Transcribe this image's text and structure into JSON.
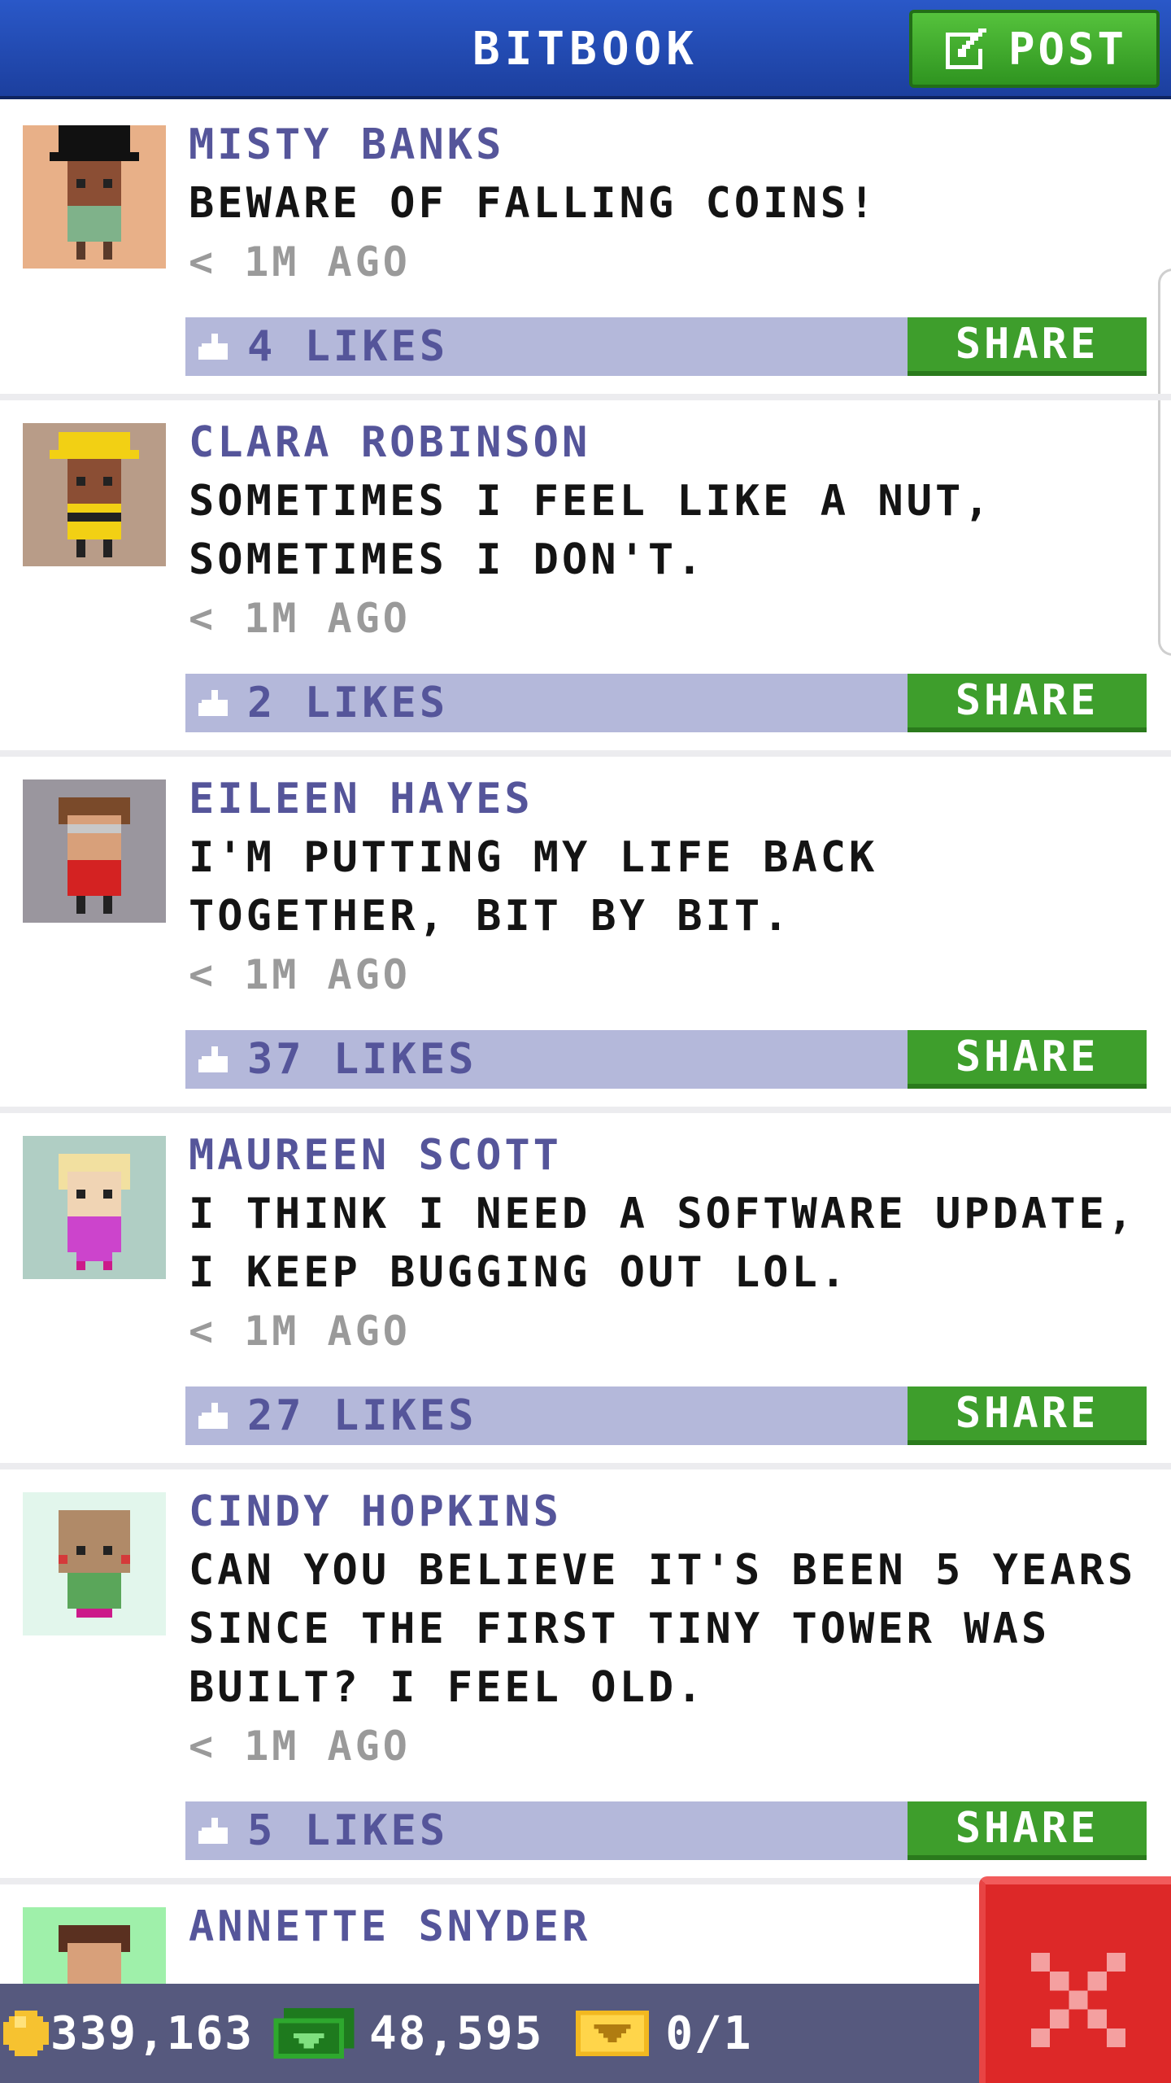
{
  "header": {
    "title": "BITBOOK",
    "post_label": "POST"
  },
  "posts": [
    {
      "name": "MISTY BANKS",
      "message": "BEWARE OF FALLING COINS!",
      "time": "< 1M AGO",
      "likes": "4 LIKES",
      "share": "SHARE"
    },
    {
      "name": "CLARA ROBINSON",
      "message": "SOMETIMES I FEEL LIKE A NUT, SOMETIMES I DON'T.",
      "time": "< 1M AGO",
      "likes": "2 LIKES",
      "share": "SHARE"
    },
    {
      "name": "EILEEN HAYES",
      "message": "I'M PUTTING MY LIFE BACK TOGETHER, BIT BY BIT.",
      "time": "< 1M AGO",
      "likes": "37 LIKES",
      "share": "SHARE"
    },
    {
      "name": "MAUREEN SCOTT",
      "message": "I THINK I NEED A SOFTWARE UPDATE, I KEEP BUGGING OUT LOL.",
      "time": "< 1M AGO",
      "likes": "27 LIKES",
      "share": "SHARE"
    },
    {
      "name": "CINDY HOPKINS",
      "message": "CAN YOU BELIEVE IT'S BEEN 5 YEARS SINCE THE FIRST TINY TOWER WAS BUILT? I FEEL OLD.",
      "time": "< 1M AGO",
      "likes": "5 LIKES",
      "share": "SHARE"
    },
    {
      "name": "ANNETTE SNYDER",
      "message": "",
      "time": "",
      "likes": "",
      "share": ""
    }
  ],
  "status_bar": {
    "coins": "339,163",
    "cash": "48,595",
    "bux": "0/1"
  },
  "colors": {
    "header_blue": "#1c3f9e",
    "post_green": "#3e9e2c",
    "name_purple": "#55559a",
    "like_bar": "#b4b8da",
    "close_red": "#dd2828",
    "bottom_bar": "#56597e"
  },
  "icons": [
    "edit-icon",
    "like-icon",
    "coin-icon",
    "cash-icon",
    "bux-icon",
    "close-icon"
  ]
}
